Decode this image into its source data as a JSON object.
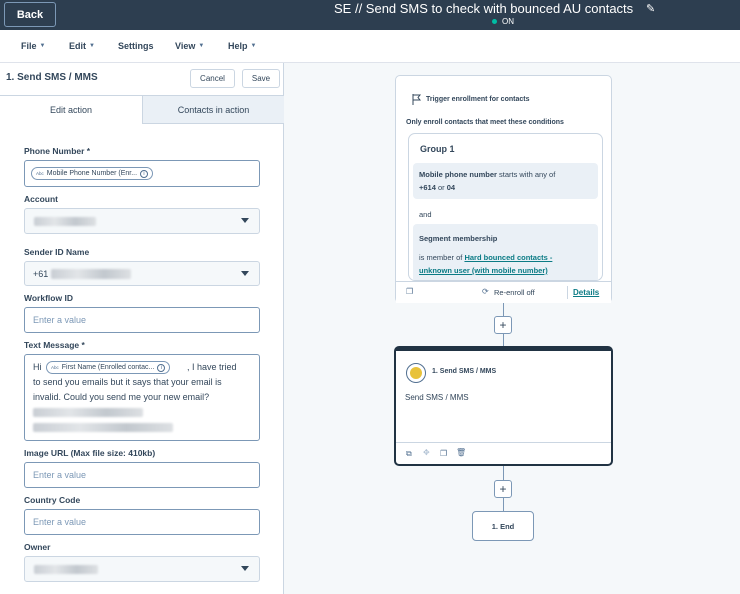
{
  "topbar": {
    "back_label": "Back",
    "workflow_title": "SE // Send SMS to check with bounced AU contacts",
    "status": "ON",
    "status_color": "#00bda5"
  },
  "menu": [
    {
      "label": "File"
    },
    {
      "label": "Edit"
    },
    {
      "label": "Settings"
    },
    {
      "label": "View"
    },
    {
      "label": "Help"
    }
  ],
  "panel": {
    "title": "1. Send SMS / MMS",
    "cancel_label": "Cancel",
    "save_label": "Save",
    "tabs": [
      {
        "label": "Edit action",
        "active": true
      },
      {
        "label": "Contacts in action",
        "active": false
      }
    ],
    "fields": {
      "phone_number": {
        "label": "Phone Number *",
        "token": "Mobile Phone Number (Enr...",
        "token_prefix": "Abc"
      },
      "account": {
        "label": "Account"
      },
      "sender_id": {
        "label": "Sender ID Name",
        "value_prefix": "+61"
      },
      "workflow_id": {
        "label": "Workflow ID",
        "placeholder": "Enter a value"
      },
      "text_message": {
        "label": "Text Message *",
        "prefix": "Hi",
        "token": "First Name (Enrolled contac...",
        "token_prefix": "Abc",
        "line1_rest": ", I have tried",
        "line2": "to send you emails but it says that your email is",
        "line3": "invalid. Could you send me your new email?"
      },
      "image_url": {
        "label": "Image URL (Max file size: 410kb)",
        "placeholder": "Enter a value"
      },
      "country_code": {
        "label": "Country Code",
        "placeholder": "Enter a value"
      },
      "owner": {
        "label": "Owner"
      }
    }
  },
  "canvas": {
    "trigger": {
      "title": "Trigger enrollment for contacts",
      "subtitle": "Only enroll contacts that meet these conditions",
      "group_title": "Group 1",
      "cond1_property": "Mobile phone number",
      "cond1_operator": " starts with any of",
      "cond1_values": "+614",
      "cond1_or": " or ",
      "cond1_values2": "04",
      "and_label": "and",
      "cond2_title": "Segment membership",
      "cond2_prefix": "is member of ",
      "cond2_link1": "Hard bounced contacts -",
      "cond2_link2": "unknown user (with mobile number)",
      "reenroll": "Re-enroll off",
      "details": "Details"
    },
    "action": {
      "name": "1. Send SMS / MMS",
      "body": "Send SMS / MMS"
    },
    "end_label": "1. End",
    "plus_label": "+"
  }
}
